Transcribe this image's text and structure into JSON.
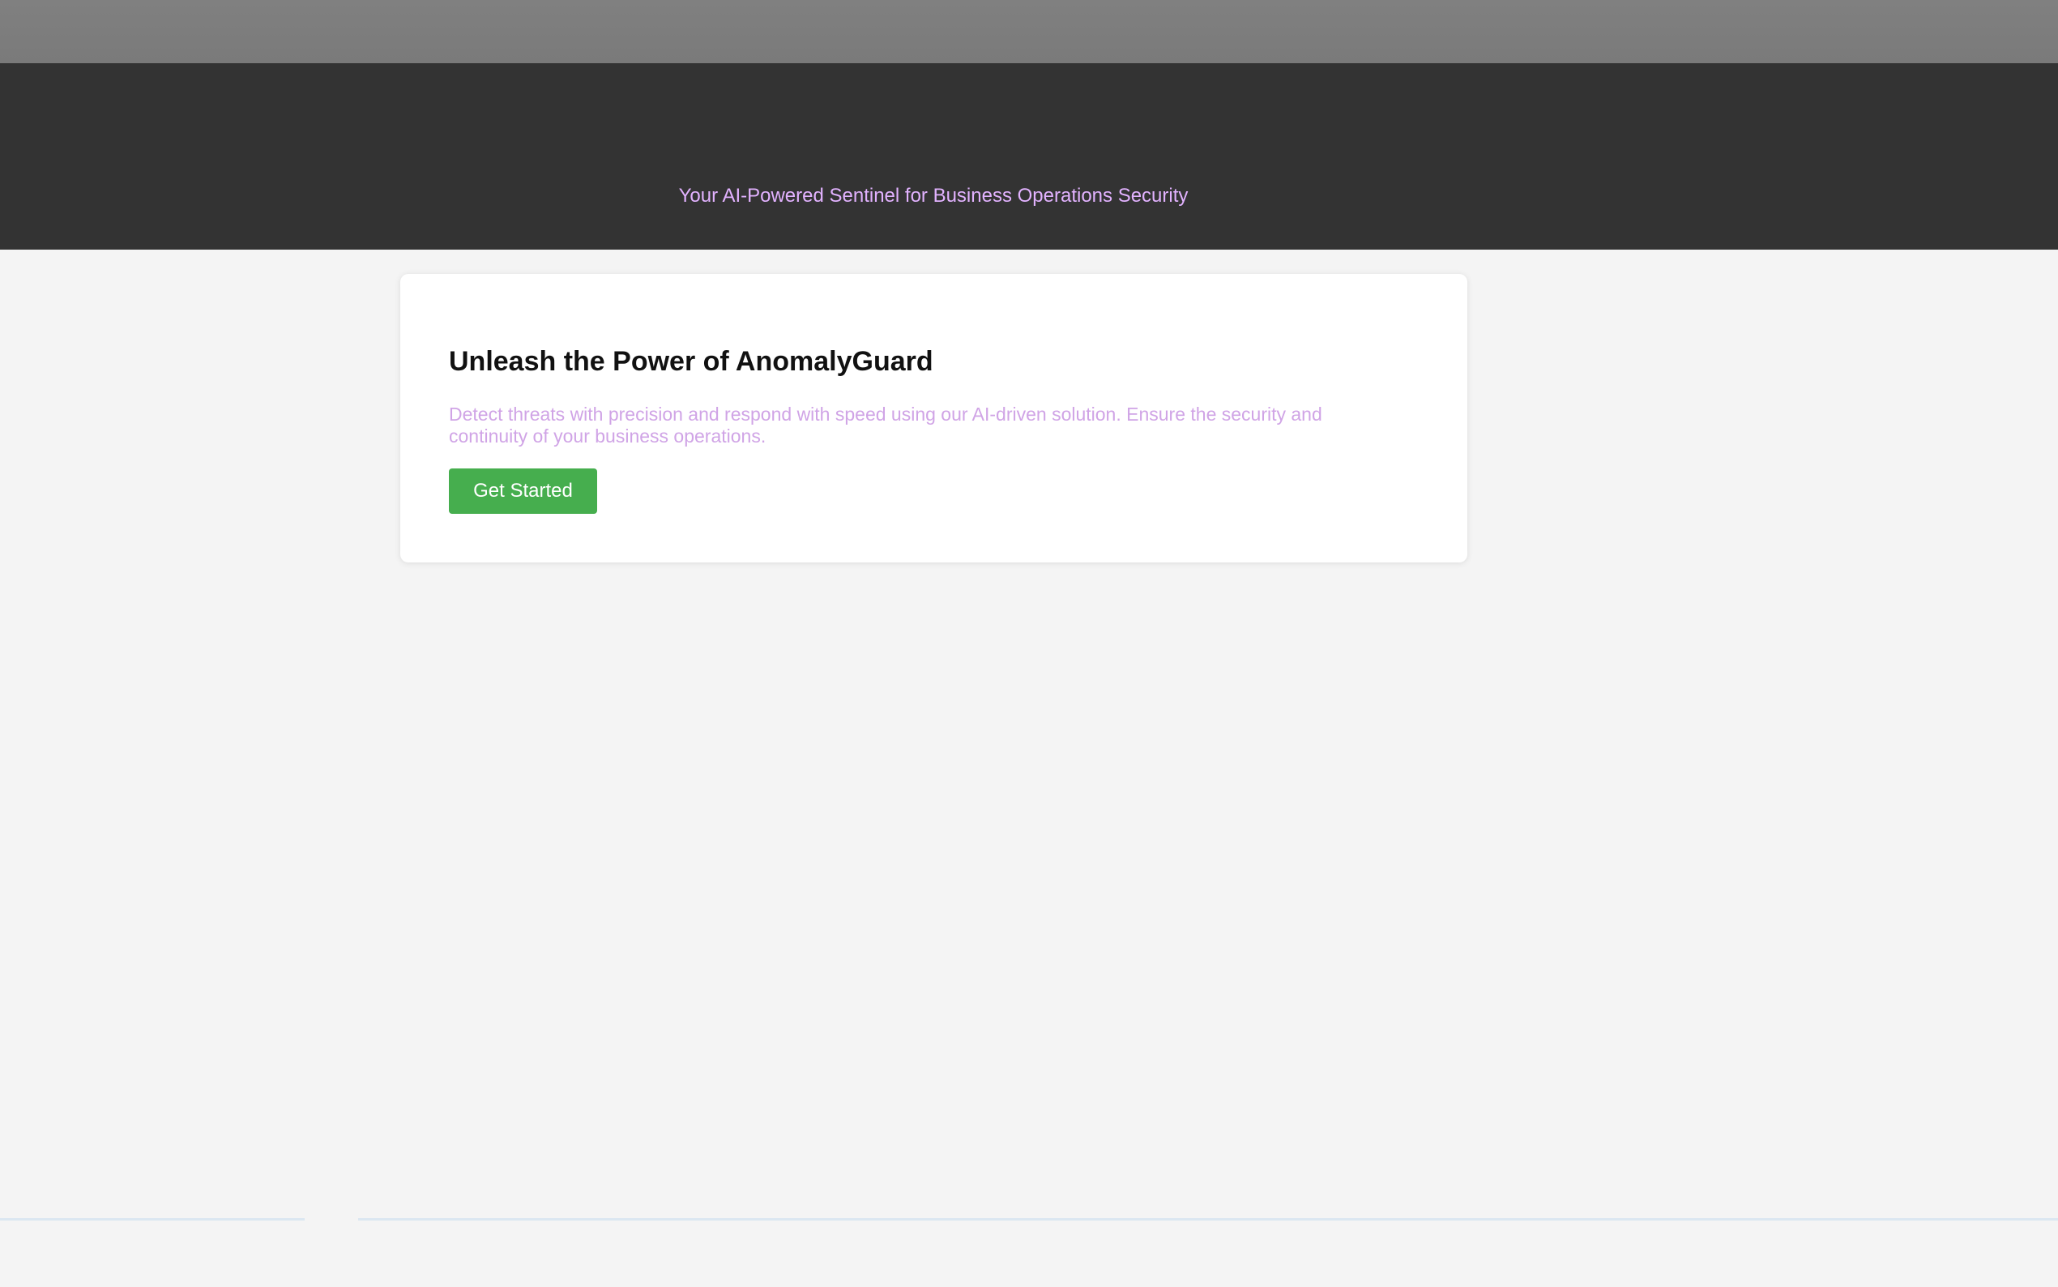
{
  "header": {
    "tagline": "Your AI-Powered Sentinel for Business Operations Security"
  },
  "hero": {
    "title": "Unleash the Power of AnomalyGuard",
    "description": "Detect threats with precision and respond with speed using our AI-driven solution. Ensure the security and continuity of your business operations.",
    "cta_label": "Get Started"
  },
  "colors": {
    "header_bg": "#333333",
    "tagline": "#e2b2ff",
    "description": "#d0a4e6",
    "cta_bg": "#46ae4e",
    "page_bg": "#f4f4f4"
  }
}
